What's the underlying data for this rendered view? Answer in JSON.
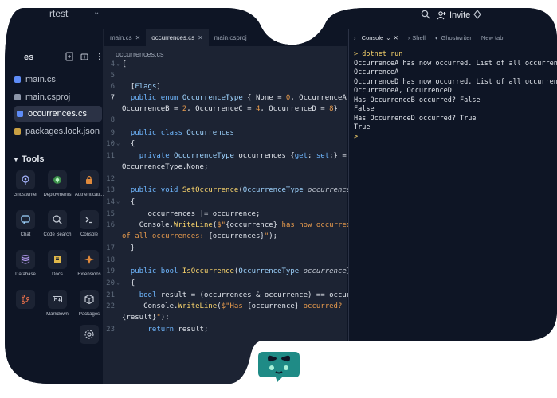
{
  "header": {
    "project_title": "rtest",
    "invite_label": "Invite"
  },
  "sidebar": {
    "files_title": "es",
    "files": [
      {
        "name": "main.cs",
        "icon": "csharp-file-icon",
        "active": false
      },
      {
        "name": "main.csproj",
        "icon": "xml-file-icon",
        "active": false
      },
      {
        "name": "occurrences.cs",
        "icon": "csharp-file-icon",
        "active": true
      },
      {
        "name": "packages.lock.json",
        "icon": "json-file-icon",
        "active": false
      }
    ],
    "tools_title": "Tools",
    "tools": [
      {
        "label": "Ghostwriter",
        "icon": "ghostwriter-icon"
      },
      {
        "label": "Deployments",
        "icon": "deployments-icon"
      },
      {
        "label": "Authenticati...",
        "icon": "authentication-icon"
      },
      {
        "label": "Chat",
        "icon": "chat-icon"
      },
      {
        "label": "Code Search",
        "icon": "code-search-icon"
      },
      {
        "label": "Console",
        "icon": "console-icon"
      },
      {
        "label": "Database",
        "icon": "database-icon"
      },
      {
        "label": "Docs",
        "icon": "docs-icon"
      },
      {
        "label": "Extensions",
        "icon": "extensions-icon"
      },
      {
        "label": "",
        "icon": "git-icon"
      },
      {
        "label": "Markdown",
        "icon": "markdown-icon"
      },
      {
        "label": "Packages",
        "icon": "packages-icon"
      },
      {
        "label": "",
        "icon": "settings-icon"
      }
    ]
  },
  "editor": {
    "tabs": [
      {
        "label": "main.cs",
        "active": false
      },
      {
        "label": "occurrences.cs",
        "active": true
      },
      {
        "label": "main.csproj",
        "active": false
      }
    ],
    "breadcrumb": "occurrences.cs",
    "line_numbers": [
      "4",
      "5",
      "6",
      "7",
      "",
      "8",
      "9",
      "10",
      "11",
      "",
      "12",
      "13",
      "14",
      "15",
      "16",
      "",
      "17",
      "18",
      "19",
      "20",
      "21",
      "22",
      "",
      "23"
    ]
  },
  "console": {
    "tabs": [
      {
        "label": "Console",
        "active": true
      },
      {
        "label": "Shell",
        "active": false
      },
      {
        "label": "Ghostwriter",
        "active": false
      },
      {
        "label": "New tab",
        "active": false
      }
    ],
    "lines": [
      "> dotnet run",
      "OccurrenceA has now occurred. List of all occurrences:",
      "OccurrenceA",
      "OccurrenceD has now occurred. List of all occurrences:",
      "OccurrenceA, OccurrenceD",
      "Has OccurrenceB occurred? False",
      "False",
      "Has OccurrenceD occurred? True",
      "True",
      ">"
    ]
  },
  "colors": {
    "background": "#0e1525",
    "editor_bg": "#1c2333",
    "keyword": "#6fb7ff",
    "type": "#9fd4ff",
    "function": "#f9d46c",
    "string": "#e69a4d",
    "logo": "#1f8b86"
  }
}
